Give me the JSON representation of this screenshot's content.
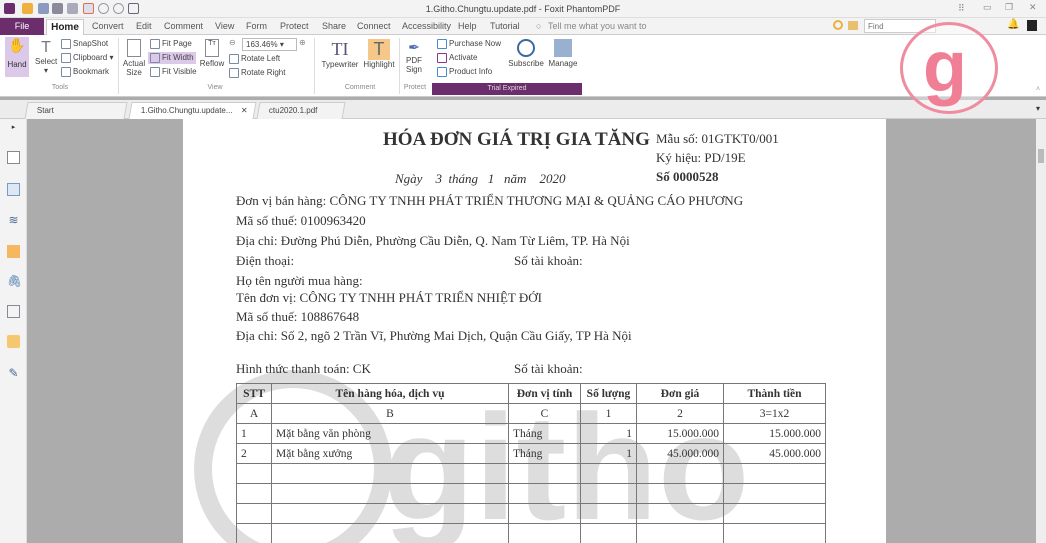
{
  "window": {
    "title": "1.Githo.Chungtu.update.pdf - Foxit PhantomPDF"
  },
  "menu": {
    "file": "File",
    "tabs": [
      "Home",
      "Convert",
      "Edit",
      "Comment",
      "View",
      "Form",
      "Protect",
      "Share",
      "Connect",
      "Accessibility",
      "Help",
      "Tutorial"
    ],
    "tell_me": "Tell me what you want to",
    "find_placeholder": "Find"
  },
  "ribbon": {
    "tools": {
      "hand": "Hand",
      "select": "Select",
      "snapshot": "SnapShot",
      "clipboard": "Clipboard",
      "bookmark": "Bookmark",
      "group": "Tools"
    },
    "view": {
      "actual_size": "Actual Size",
      "fit_page": "Fit Page",
      "fit_width": "Fit Width",
      "fit_visible": "Fit Visible",
      "reflow": "Reflow",
      "zoom": "163.46%",
      "rotate_left": "Rotate Left",
      "rotate_right": "Rotate Right",
      "group": "View"
    },
    "comment": {
      "typewriter": "Typewriter",
      "highlight": "Highlight",
      "group": "Comment"
    },
    "protect": {
      "pdf_sign": "PDF Sign",
      "group": "Protect"
    },
    "trial": {
      "purchase": "Purchase Now",
      "activate": "Activate",
      "product_info": "Product Info",
      "subscribe": "Subscribe",
      "manage": "Manage",
      "group": "Trial Expired"
    }
  },
  "doc_tabs": [
    "Start",
    "1.Githo.Chungtu.update...",
    "ctu2020.1.pdf"
  ],
  "invoice": {
    "title": "HÓA ĐƠN GIÁ TRỊ GIA TĂNG",
    "mau_so": "Mẫu số: 01GTKT0/001",
    "ky_hieu": "Ký hiệu: PD/19E",
    "so": "Số 0000528",
    "date": "Ngày    3  tháng   1   năm    2020",
    "seller": "Đơn vị bán hàng:  CÔNG TY TNHH PHÁT TRIỂN THƯƠNG MẠI & QUẢNG CÁO PHƯƠNG",
    "seller_tax": "Mã số thuế:  0100963420",
    "seller_addr": "Địa chỉ: Đường Phú Diễn, Phường Cầu Diễn, Q. Nam Từ Liêm, TP. Hà Nội",
    "phone": "Điện thoại:",
    "account1": "Số tài khoản:",
    "buyer_name": "Họ tên người mua hàng:",
    "buyer_unit": "Tên đơn vị:  CÔNG TY TNHH PHÁT TRIỂN NHIỆT ĐỚI",
    "buyer_tax": "Mã số thuế:  108867648",
    "buyer_addr": "Địa chỉ: Số 2, ngõ 2 Trần Vĩ, Phường Mai Dịch, Quận Cầu Giấy, TP Hà Nội",
    "payment": "Hình thức thanh toán:  CK",
    "account2": "Số tài khoản:",
    "headers": [
      "STT",
      "Tên hàng hóa, dịch vụ",
      "Đơn vị tính",
      "Số lượng",
      "Đơn giá",
      "Thành tiền"
    ],
    "codes": [
      "A",
      "B",
      "C",
      "1",
      "2",
      "3=1x2"
    ],
    "rows": [
      [
        "1",
        "Mặt bằng văn phòng",
        "Tháng",
        "1",
        "15.000.000",
        "15.000.000"
      ],
      [
        "2",
        "Mặt bằng xưởng",
        "Tháng",
        "1",
        "45.000.000",
        "45.000.000"
      ]
    ]
  },
  "watermark": "gitiho"
}
